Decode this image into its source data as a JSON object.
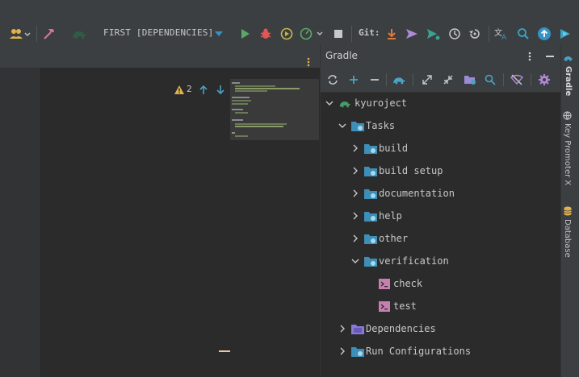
{
  "toolbar": {
    "run_config": "FIRST [DEPENDENCIES]",
    "git_label": "Git:"
  },
  "editor": {
    "problems_count": "2"
  },
  "gradle": {
    "title": "Gradle",
    "tree": [
      {
        "label": "kyuroject"
      },
      {
        "label": "Tasks"
      },
      {
        "label": "build"
      },
      {
        "label": "build setup"
      },
      {
        "label": "documentation"
      },
      {
        "label": "help"
      },
      {
        "label": "other"
      },
      {
        "label": "verification"
      },
      {
        "label": "check"
      },
      {
        "label": "test"
      },
      {
        "label": "Dependencies"
      },
      {
        "label": "Run Configurations"
      }
    ]
  },
  "right_tabs": {
    "gradle": "Gradle",
    "key_promoter": "Key Promoter X",
    "database": "Database"
  },
  "colors": {
    "accent_blue": "#3592c4",
    "run_green": "#59a869",
    "debug_red": "#e05555",
    "gradle_green": "#4a9c6d"
  }
}
